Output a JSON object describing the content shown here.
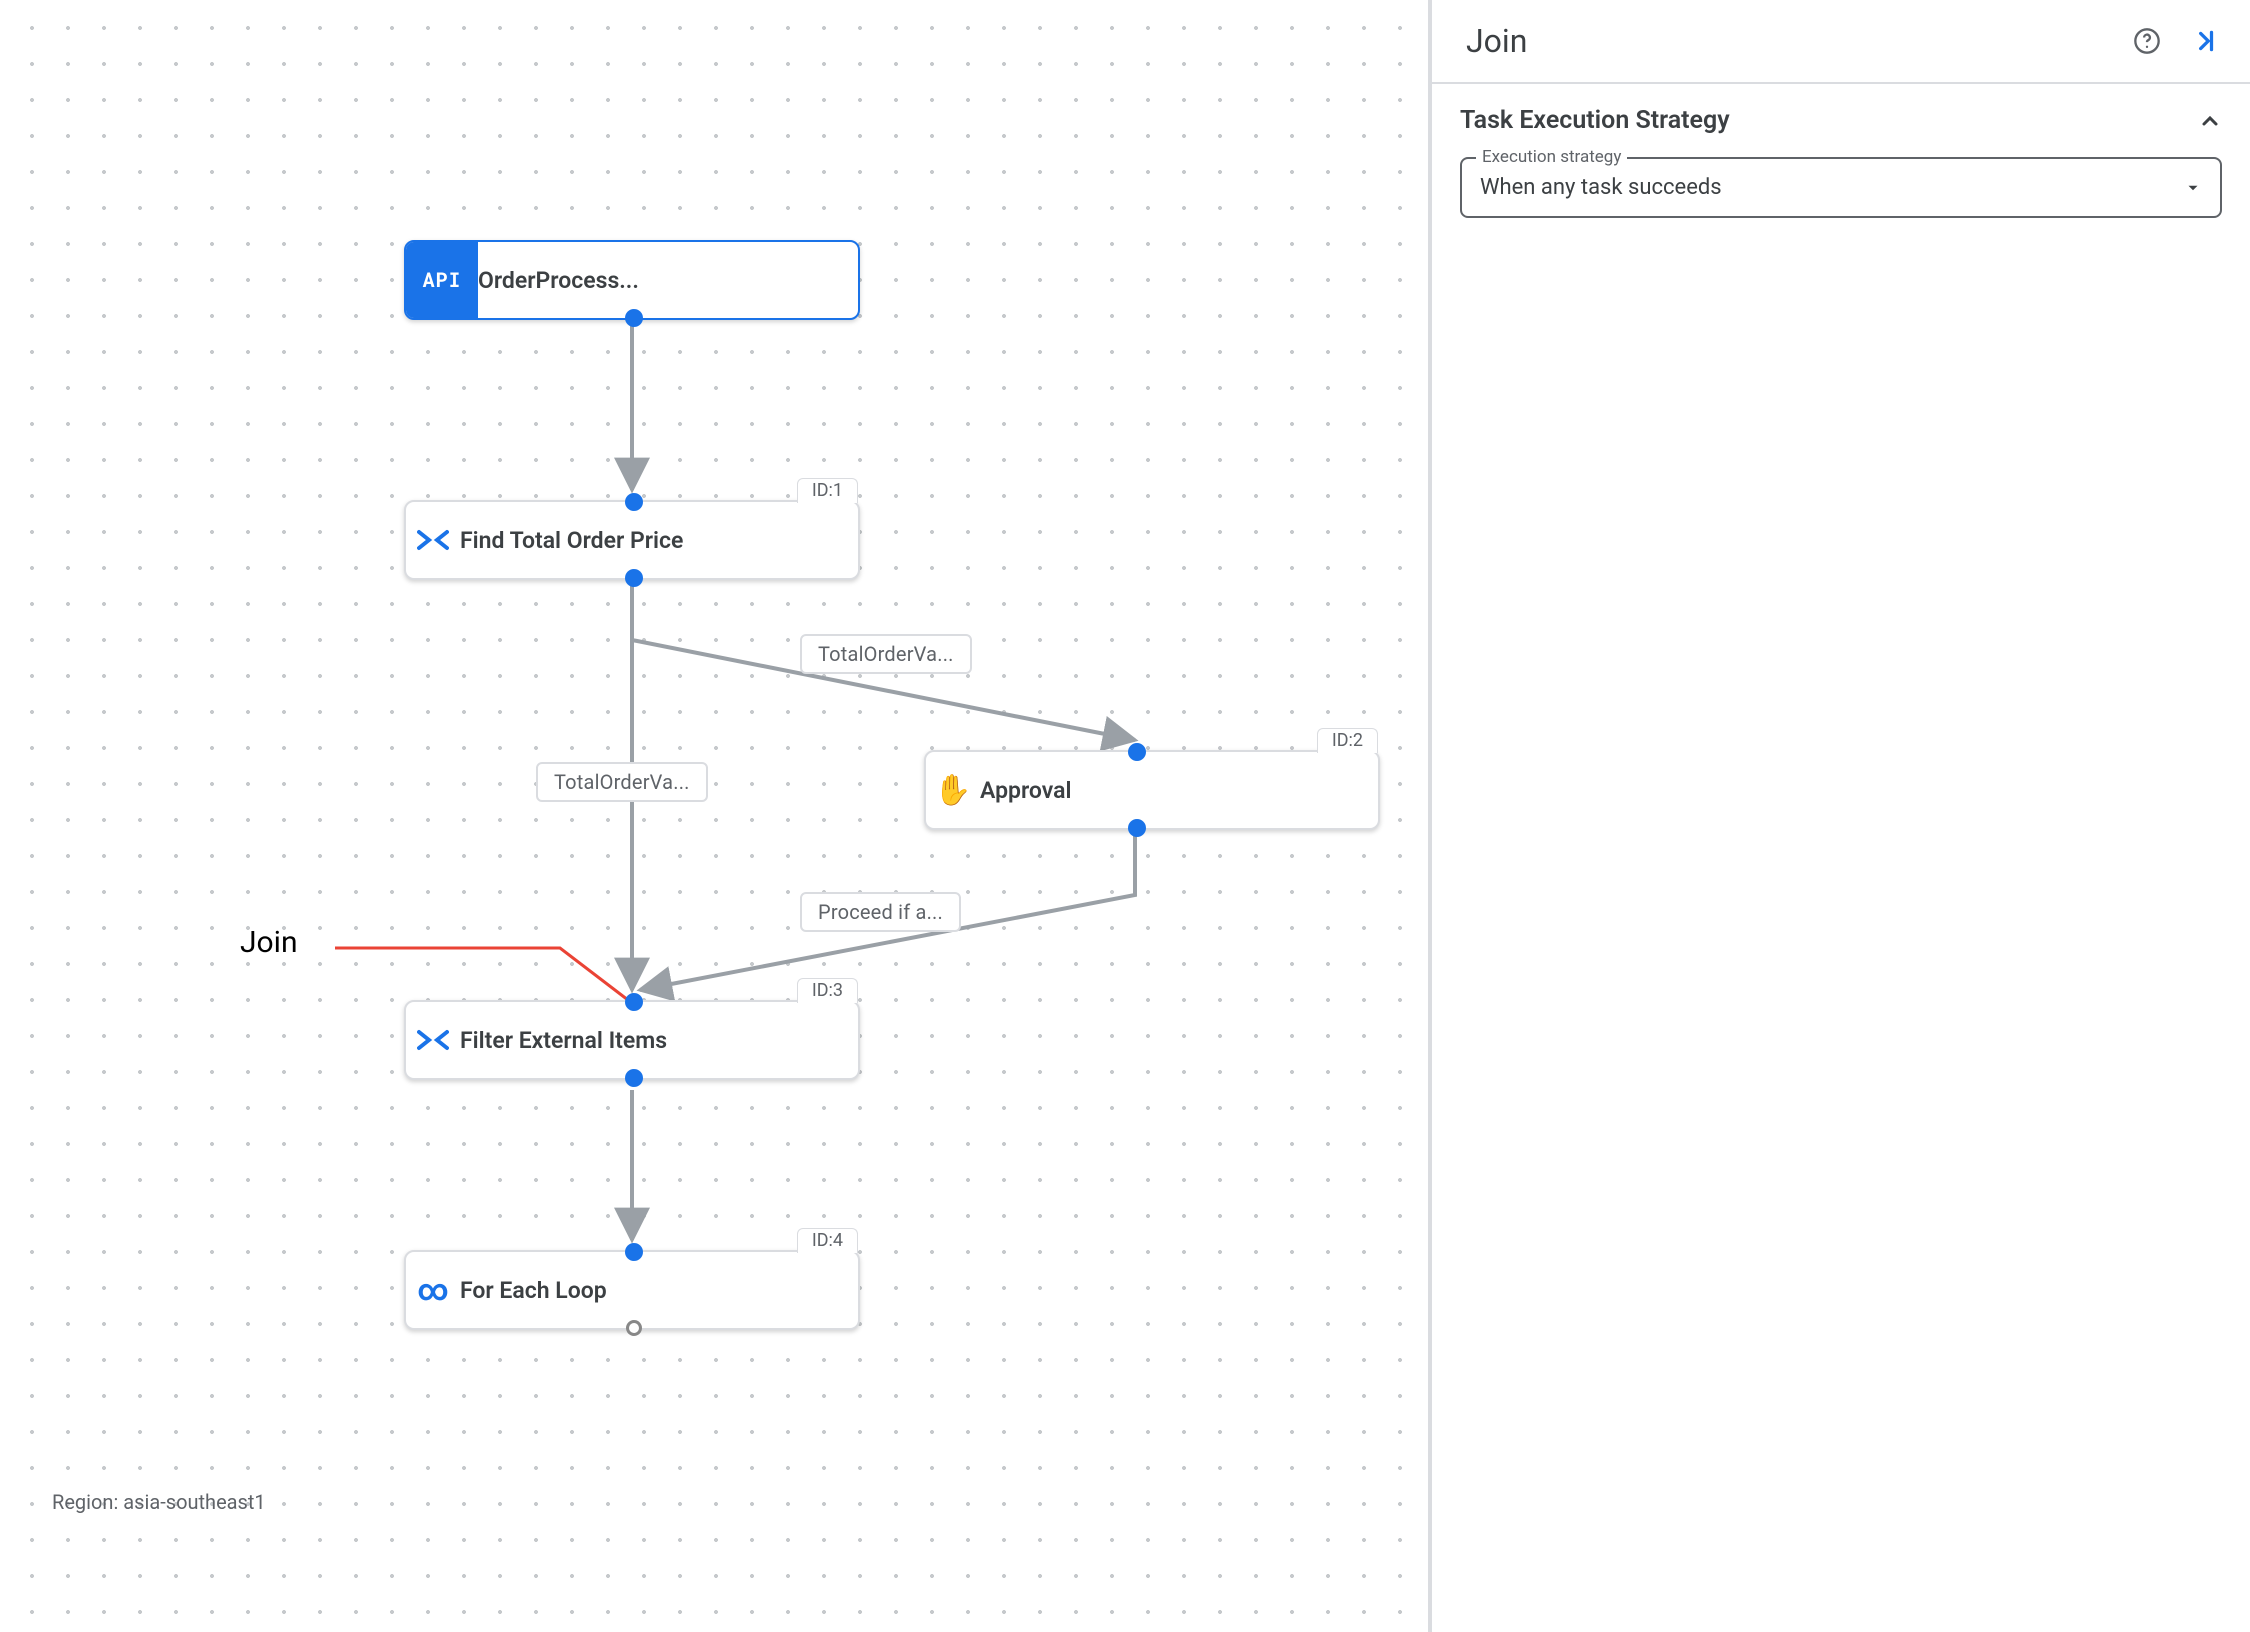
{
  "panel": {
    "title": "Join",
    "section_title": "Task Execution Strategy",
    "select_label": "Execution strategy",
    "select_value": "When any task succeeds"
  },
  "callout_label": "Join",
  "region_label": "Region: asia-southeast1",
  "nodes": {
    "trigger": {
      "label": "OrderProcess...",
      "icon_text": "API"
    },
    "findTotal": {
      "label": "Find Total Order Price",
      "id": "ID:1"
    },
    "approval": {
      "label": "Approval",
      "id": "ID:2"
    },
    "filter": {
      "label": "Filter External Items",
      "id": "ID:3"
    },
    "loop": {
      "label": "For Each Loop",
      "id": "ID:4"
    }
  },
  "edgeLabels": {
    "l1": "TotalOrderVa...",
    "l2": "TotalOrderVa...",
    "l3": "Proceed if a..."
  }
}
